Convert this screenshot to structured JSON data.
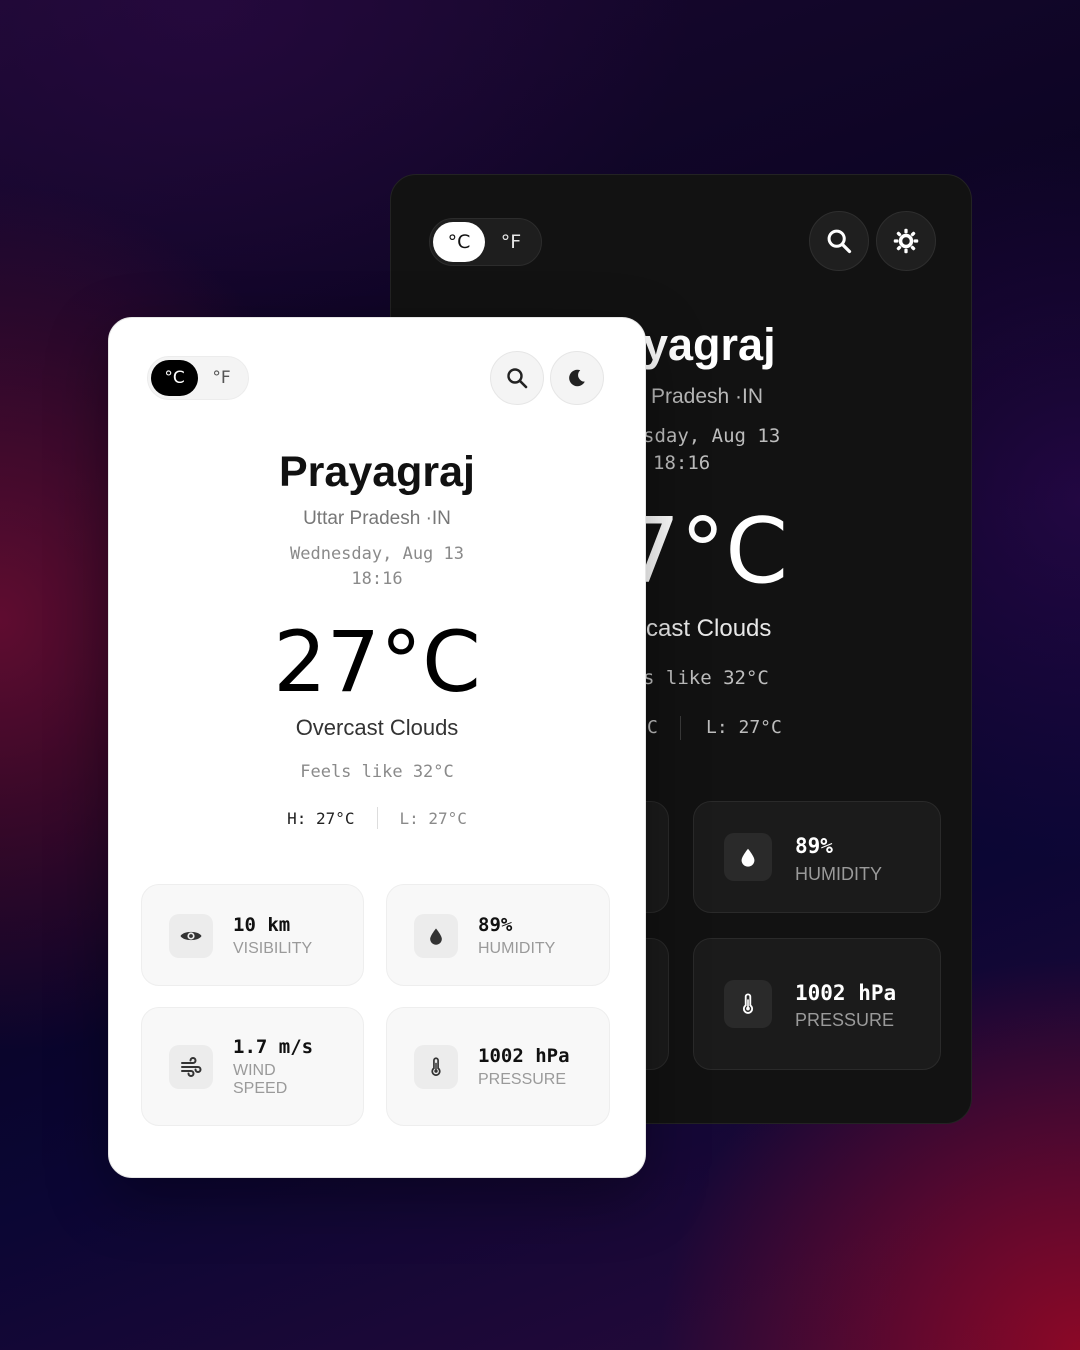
{
  "units": {
    "celsius": "°C",
    "fahrenheit": "°F"
  },
  "location": {
    "city": "Prayagraj",
    "region": "Uttar Pradesh ·IN"
  },
  "datetime": {
    "date": "Wednesday, Aug 13",
    "time": "18:16"
  },
  "weather": {
    "temperature": "27°C",
    "condition": "Overcast Clouds",
    "feels_like": "Feels like 32°C",
    "high": "H: 27°C",
    "low": "L: 27°C"
  },
  "stats": {
    "visibility": {
      "value": "10 km",
      "label": "VISIBILITY",
      "icon": "eye-icon"
    },
    "humidity": {
      "value": "89%",
      "label": "HUMIDITY",
      "icon": "droplet-icon"
    },
    "wind": {
      "value": "1.7 m/s",
      "label_line1": "WIND",
      "label_line2": "SPEED",
      "icon": "wind-icon"
    },
    "pressure": {
      "value": "1002 hPa",
      "label": "PRESSURE",
      "icon": "thermometer-icon"
    }
  },
  "dark_view": {
    "city_partial": "yagraj",
    "region_partial": "Pradesh ·IN",
    "date_partial": "sday, Aug 13",
    "time": "18:16",
    "temperature_partial": "7°C",
    "condition_partial": "cast Clouds",
    "feels_partial": "s like 32°C",
    "high_partial": "C",
    "low": "L: 27°C"
  },
  "colors": {
    "light_card": "#ffffff",
    "dark_card": "#121212",
    "stat_light": "#f8f8f8",
    "stat_dark": "#1b1b1b"
  },
  "icons": {
    "light_search": "search-icon",
    "light_theme": "moon-icon",
    "dark_search": "search-icon",
    "dark_theme": "sun-icon"
  }
}
